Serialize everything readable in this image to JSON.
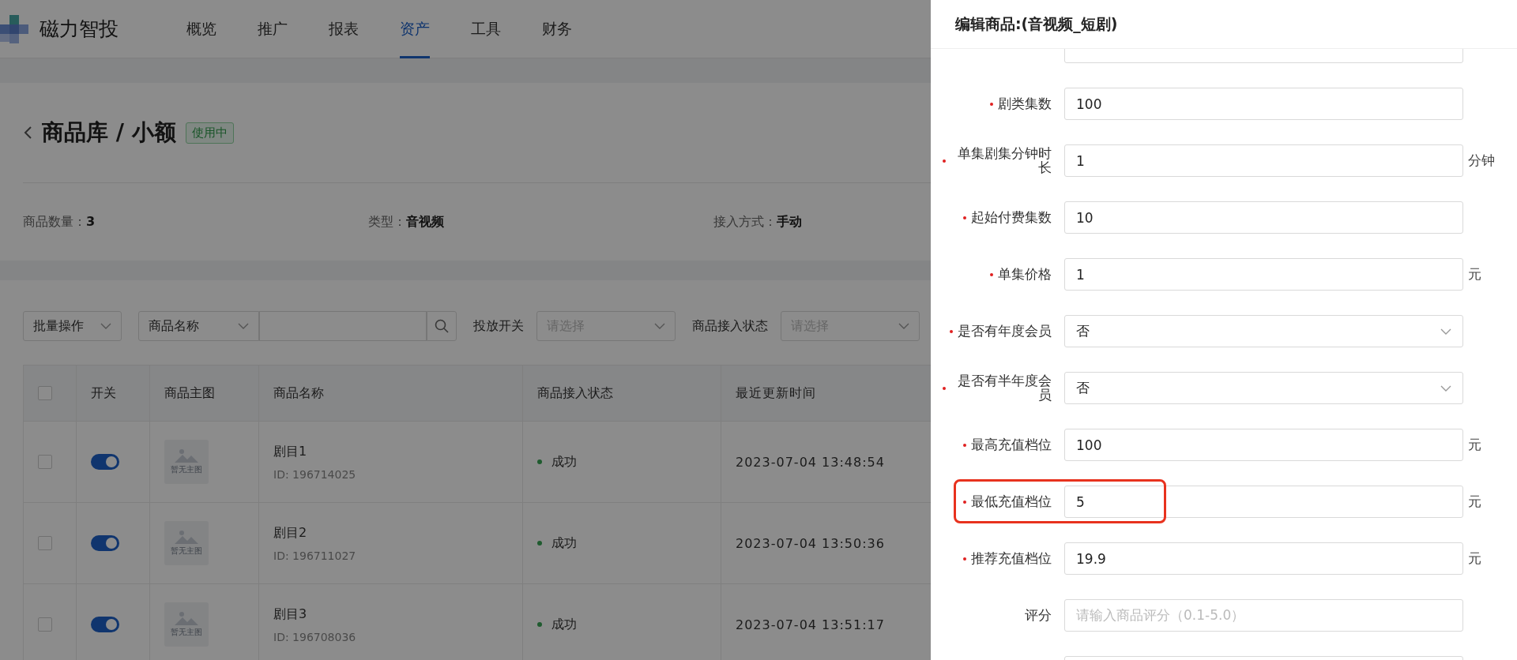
{
  "app": {
    "logo": "磁力智投"
  },
  "nav": [
    {
      "label": "概览",
      "selected": false
    },
    {
      "label": "推广",
      "selected": false
    },
    {
      "label": "报表",
      "selected": false
    },
    {
      "label": "资产",
      "selected": true
    },
    {
      "label": "工具",
      "selected": false
    },
    {
      "label": "财务",
      "selected": false
    }
  ],
  "page": {
    "title": "商品库 / 小额",
    "status_tag": "使用中",
    "info": [
      {
        "label": "商品数量：",
        "value": "3"
      },
      {
        "label": "类型：",
        "value": "音视频"
      },
      {
        "label": "接入方式：",
        "value": "手动"
      }
    ]
  },
  "filters": {
    "batch": "批量操作",
    "search_type": "商品名称",
    "switch_label": "投放开关",
    "switch_placeholder": "请选择",
    "status_label": "商品接入状态",
    "status_placeholder": "请选择"
  },
  "table": {
    "select_all": {
      "checked": false
    },
    "columns": [
      "开关",
      "商品主图",
      "商品名称",
      "商品接入状态",
      "最近更新时间"
    ],
    "rows": [
      {
        "checked": false,
        "on": true,
        "image_placeholder": "暂无主图",
        "name": "剧目1",
        "id": "ID: 196714025",
        "status": "成功",
        "updated": "2023-07-04 13:48:54"
      },
      {
        "checked": false,
        "on": true,
        "image_placeholder": "暂无主图",
        "name": "剧目2",
        "id": "ID: 196711027",
        "status": "成功",
        "updated": "2023-07-04 13:50:36"
      },
      {
        "checked": false,
        "on": true,
        "image_placeholder": "暂无主图",
        "name": "剧目3",
        "id": "ID: 196708036",
        "status": "成功",
        "updated": "2023-07-04 13:51:17"
      }
    ]
  },
  "drawer": {
    "title": "编辑商品:(音视频_短剧)",
    "fields": [
      {
        "kind": "input",
        "label": "剧类集数",
        "required": true,
        "value": "100",
        "highlighted": false
      },
      {
        "kind": "input",
        "label": "单集剧集分钟时长",
        "required": true,
        "value": "1",
        "suffix": "分钟",
        "highlighted": false
      },
      {
        "kind": "input",
        "label": "起始付费集数",
        "required": true,
        "value": "10",
        "highlighted": false
      },
      {
        "kind": "input",
        "label": "单集价格",
        "required": true,
        "value": "1",
        "suffix": "元",
        "highlighted": false
      },
      {
        "kind": "select",
        "label": "是否有年度会员",
        "required": true,
        "value": "否",
        "highlighted": false
      },
      {
        "kind": "select",
        "label": "是否有半年度会员",
        "required": true,
        "value": "否",
        "highlighted": false
      },
      {
        "kind": "input",
        "label": "最高充值档位",
        "required": true,
        "value": "100",
        "suffix": "元",
        "highlighted": false
      },
      {
        "kind": "input",
        "label": "最低充值档位",
        "required": true,
        "value": "5",
        "suffix": "元",
        "highlighted": true
      },
      {
        "kind": "input",
        "label": "推荐充值档位",
        "required": true,
        "value": "19.9",
        "suffix": "元",
        "highlighted": false
      },
      {
        "kind": "input",
        "label": "评分",
        "required": false,
        "placeholder": "请输入商品评分（0.1-5.0）",
        "highlighted": false
      }
    ]
  }
}
